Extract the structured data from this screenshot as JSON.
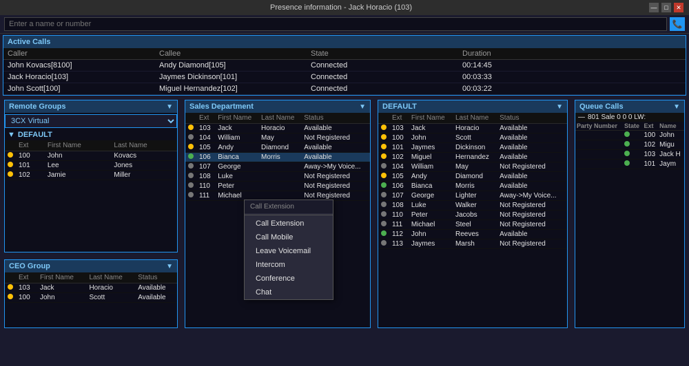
{
  "titleBar": {
    "title": "Presence information - Jack Horacio (103)",
    "controls": [
      "minimize",
      "maximize",
      "close"
    ]
  },
  "search": {
    "placeholder": "Enter a name or number"
  },
  "activeCalls": {
    "header": "Active Calls",
    "columns": [
      "Caller",
      "Callee",
      "State",
      "Duration"
    ],
    "rows": [
      {
        "caller": "John Kovacs[8100]",
        "callee": "Andy Diamond[105]",
        "state": "Connected",
        "duration": "00:14:45"
      },
      {
        "caller": "Jack Horacio[103]",
        "callee": "Jaymes Dickinson[101]",
        "state": "Connected",
        "duration": "00:03:33"
      },
      {
        "caller": "John Scott[100]",
        "callee": "Miguel Hernandez[102]",
        "state": "Connected",
        "duration": "00:03:22"
      }
    ]
  },
  "remoteGroups": {
    "header": "Remote Groups",
    "dropdown": "3CX Virtual",
    "groupLabel": "DEFAULT",
    "columns": [
      "Ext",
      "First Name",
      "Last Name"
    ],
    "rows": [
      {
        "ext": "100",
        "firstName": "John",
        "lastName": "Kovacs",
        "status": "yellow"
      },
      {
        "ext": "101",
        "firstName": "Lee",
        "lastName": "Jones",
        "status": "yellow"
      },
      {
        "ext": "102",
        "firstName": "Jamie",
        "lastName": "Miller",
        "status": "yellow"
      }
    ]
  },
  "salesDepartment": {
    "header": "Sales Department",
    "columns": [
      "Ext",
      "First Name",
      "Last Name",
      "Status"
    ],
    "rows": [
      {
        "ext": "103",
        "firstName": "Jack",
        "lastName": "Horacio",
        "status": "Available",
        "dot": "yellow"
      },
      {
        "ext": "104",
        "firstName": "William",
        "lastName": "May",
        "status": "Not Registered",
        "dot": "gray"
      },
      {
        "ext": "105",
        "firstName": "Andy",
        "lastName": "Diamond",
        "status": "Available",
        "dot": "yellow"
      },
      {
        "ext": "106",
        "firstName": "Bianca",
        "lastName": "Morris",
        "status": "Available",
        "dot": "green",
        "highlighted": true
      },
      {
        "ext": "107",
        "firstName": "George",
        "lastName": "",
        "status": "Away->My Voice...",
        "dot": "gray"
      },
      {
        "ext": "108",
        "firstName": "Luke",
        "lastName": "",
        "status": "Not Registered",
        "dot": "gray"
      },
      {
        "ext": "110",
        "firstName": "Peter",
        "lastName": "",
        "status": "Not Registered",
        "dot": "gray"
      },
      {
        "ext": "111",
        "firstName": "Michael",
        "lastName": "",
        "status": "Not Registered",
        "dot": "gray"
      }
    ]
  },
  "contextMenu": {
    "header": "Call Extension",
    "items": [
      "Call Extension",
      "Call Mobile",
      "Leave Voicemail",
      "Intercom",
      "Conference",
      "Chat"
    ]
  },
  "defaultGroup": {
    "header": "DEFAULT",
    "columns": [
      "Ext",
      "First Name",
      "Last Name",
      "Status"
    ],
    "rows": [
      {
        "ext": "103",
        "firstName": "Jack",
        "lastName": "Horacio",
        "status": "Available",
        "dot": "yellow"
      },
      {
        "ext": "100",
        "firstName": "John",
        "lastName": "Scott",
        "status": "Available",
        "dot": "yellow"
      },
      {
        "ext": "101",
        "firstName": "Jaymes",
        "lastName": "Dickinson",
        "status": "Available",
        "dot": "yellow"
      },
      {
        "ext": "102",
        "firstName": "Miguel",
        "lastName": "Hernandez",
        "status": "Available",
        "dot": "yellow"
      },
      {
        "ext": "104",
        "firstName": "William",
        "lastName": "May",
        "status": "Not Registered",
        "dot": "gray"
      },
      {
        "ext": "105",
        "firstName": "Andy",
        "lastName": "Diamond",
        "status": "Available",
        "dot": "yellow"
      },
      {
        "ext": "106",
        "firstName": "Bianca",
        "lastName": "Morris",
        "status": "Available",
        "dot": "green"
      },
      {
        "ext": "107",
        "firstName": "George",
        "lastName": "Lighter",
        "status": "Away->My Voice...",
        "dot": "gray"
      },
      {
        "ext": "108",
        "firstName": "Luke",
        "lastName": "Walker",
        "status": "Not Registered",
        "dot": "gray"
      },
      {
        "ext": "110",
        "firstName": "Peter",
        "lastName": "Jacobs",
        "status": "Not Registered",
        "dot": "gray"
      },
      {
        "ext": "111",
        "firstName": "Michael",
        "lastName": "Steel",
        "status": "Not Registered",
        "dot": "gray"
      },
      {
        "ext": "112",
        "firstName": "John",
        "lastName": "Reeves",
        "status": "Available",
        "dot": "green"
      },
      {
        "ext": "113",
        "firstName": "Jaymes",
        "lastName": "Marsh",
        "status": "Not Registered",
        "dot": "gray"
      }
    ]
  },
  "queueCalls": {
    "header": "Queue Calls",
    "queueInfo": "801 Sale 0 0 0 LW:",
    "columns": [
      "Party Number",
      "State",
      "Ext",
      "Name"
    ],
    "rows": [
      {
        "partyNumber": "",
        "state": "",
        "ext": "100",
        "name": "John",
        "dot": "green"
      },
      {
        "partyNumber": "",
        "state": "",
        "ext": "102",
        "name": "Migu",
        "dot": "green"
      },
      {
        "partyNumber": "",
        "state": "",
        "ext": "103",
        "name": "Jack H",
        "dot": "green"
      },
      {
        "partyNumber": "",
        "state": "",
        "ext": "101",
        "name": "Jaym",
        "dot": "green"
      }
    ]
  },
  "ceoGroup": {
    "header": "CEO Group",
    "columns": [
      "Ext",
      "First Name",
      "Last Name",
      "Status"
    ],
    "rows": [
      {
        "ext": "103",
        "firstName": "Jack",
        "lastName": "Horacio",
        "status": "Available",
        "dot": "yellow"
      },
      {
        "ext": "100",
        "firstName": "John",
        "lastName": "Scott",
        "status": "Available",
        "dot": "yellow"
      }
    ]
  }
}
